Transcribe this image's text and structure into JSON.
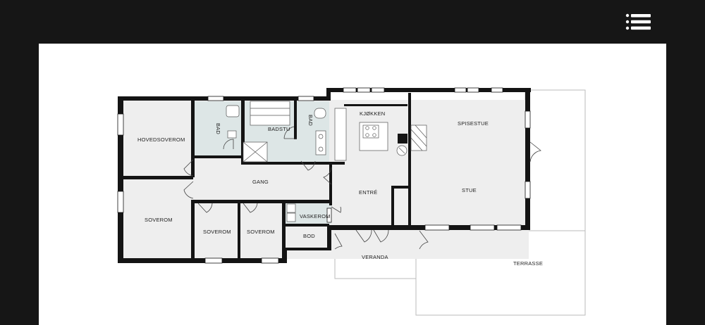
{
  "header": {
    "menu_icon": "hamburger-list-icon"
  },
  "colors": {
    "background": "#161616",
    "sheet": "#ffffff",
    "floor": "#eeeeee",
    "wet_room": "#dde6e6",
    "wall": "#141414"
  },
  "rooms": {
    "hovedsoverom": "HOVEDSOVEROM",
    "bad1": "BAD",
    "badstu": "BADSTU",
    "bad2": "BAD",
    "kjokken": "KJØKKEN",
    "spisestue": "SPISESTUE",
    "gang": "GANG",
    "entre": "ENTRÉ",
    "stue": "STUE",
    "soverom1": "SOVEROM",
    "soverom2": "SOVEROM",
    "soverom3": "SOVEROM",
    "vaskerom": "VASKEROM",
    "bod": "BOD",
    "veranda": "VERANDA",
    "terrasse": "TERRASSE"
  }
}
